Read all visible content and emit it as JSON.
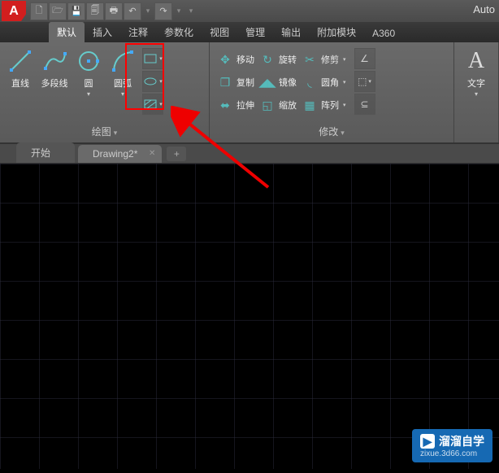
{
  "app": {
    "logo": "A",
    "title": "Auto"
  },
  "qat": {
    "new": "🗋",
    "open": "🗁",
    "save": "💾",
    "saveall": "🗐",
    "print": "🖶",
    "undo": "↶",
    "redo": "↷"
  },
  "tabs": {
    "default": "默认",
    "insert": "插入",
    "annotate": "注释",
    "parametric": "参数化",
    "view": "视图",
    "manage": "管理",
    "output": "输出",
    "addins": "附加模块",
    "a360": "A360"
  },
  "draw": {
    "panel_title": "绘图",
    "line": "直线",
    "polyline": "多段线",
    "circle": "圆",
    "arc": "圆弧"
  },
  "modify": {
    "panel_title": "修改",
    "move": "移动",
    "copy": "复制",
    "stretch": "拉伸",
    "rotate": "旋转",
    "mirror": "镜像",
    "scale": "缩放",
    "trim": "修剪",
    "fillet": "圆角",
    "array": "阵列"
  },
  "annotation": {
    "text": "文字"
  },
  "file_tabs": {
    "start": "开始",
    "drawing": "Drawing2*"
  },
  "watermark": {
    "brand": "溜溜自学",
    "url": "zixue.3d66.com"
  }
}
